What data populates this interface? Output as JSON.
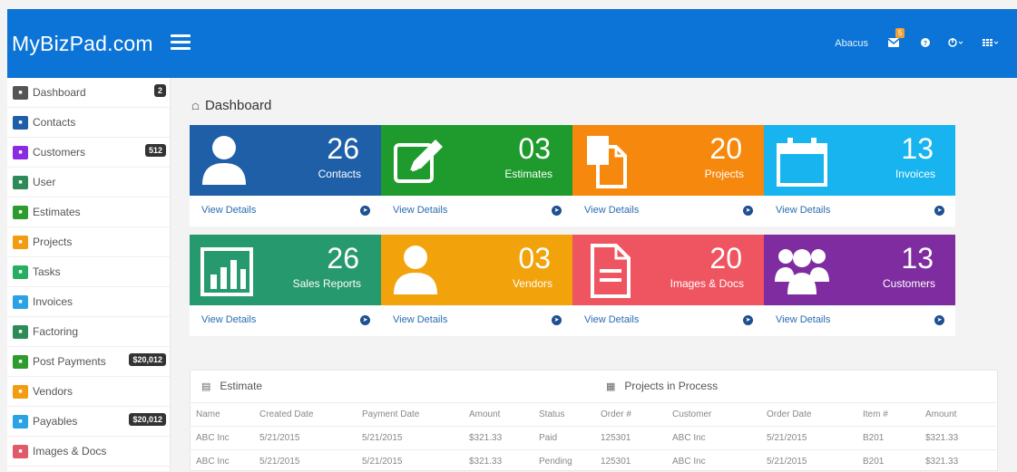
{
  "brand": "MyBizPad.com",
  "topbar": {
    "user": "Abacus",
    "mail_count": "5"
  },
  "sidebar": {
    "items": [
      {
        "label": "Dashboard",
        "icon": "dashboard-icon",
        "color": "#555555",
        "badge": "2"
      },
      {
        "label": "Contacts",
        "icon": "contacts-icon",
        "color": "#1f5ea8",
        "badge": ""
      },
      {
        "label": "Customers",
        "icon": "customers-icon",
        "color": "#8a2be2",
        "badge": "512"
      },
      {
        "label": "User",
        "icon": "user-icon",
        "color": "#2e8b57",
        "badge": ""
      },
      {
        "label": "Estimates",
        "icon": "estimates-icon",
        "color": "#2e9b2e",
        "badge": ""
      },
      {
        "label": "Projects",
        "icon": "projects-icon",
        "color": "#f39c12",
        "badge": ""
      },
      {
        "label": "Tasks",
        "icon": "tasks-icon",
        "color": "#27ae60",
        "badge": ""
      },
      {
        "label": "Invoices",
        "icon": "invoices-icon",
        "color": "#2aa3e6",
        "badge": ""
      },
      {
        "label": "Factoring",
        "icon": "factoring-icon",
        "color": "#2e8b57",
        "badge": ""
      },
      {
        "label": "Post Payments",
        "icon": "post-payments-icon",
        "color": "#2e9b2e",
        "badge": "$20,012"
      },
      {
        "label": "Vendors",
        "icon": "vendors-icon",
        "color": "#f39c12",
        "badge": ""
      },
      {
        "label": "Payables",
        "icon": "payables-icon",
        "color": "#2aa3e6",
        "badge": "$20,012"
      },
      {
        "label": "Images & Docs",
        "icon": "images-docs-icon",
        "color": "#e05b6a",
        "badge": ""
      }
    ]
  },
  "breadcrumb": "Dashboard",
  "tiles": [
    {
      "count": "26",
      "label": "Contacts",
      "color": "#1e5fa8",
      "icon": "user-icon",
      "link": "View Details"
    },
    {
      "count": "03",
      "label": "Estimates",
      "color": "#1f9b2d",
      "icon": "edit-icon",
      "link": "View Details"
    },
    {
      "count": "20",
      "label": "Projects",
      "color": "#f6890d",
      "icon": "files-icon",
      "link": "View Details"
    },
    {
      "count": "13",
      "label": "Invoices",
      "color": "#18b4ef",
      "icon": "calendar-icon",
      "link": "View Details"
    },
    {
      "count": "26",
      "label": "Sales Reports",
      "color": "#27996f",
      "icon": "bar-chart-icon",
      "link": "View Details"
    },
    {
      "count": "03",
      "label": "Vendors",
      "color": "#f2a20b",
      "icon": "user-icon",
      "link": "View Details"
    },
    {
      "count": "20",
      "label": "Images & Docs",
      "color": "#ef5560",
      "icon": "document-icon",
      "link": "View Details"
    },
    {
      "count": "13",
      "label": "Customers",
      "color": "#7f2ca0",
      "icon": "group-icon",
      "link": "View Details"
    }
  ],
  "estimate_panel": {
    "title": "Estimate",
    "columns": [
      "Name",
      "Created Date",
      "Payment Date",
      "Amount",
      "Status"
    ],
    "rows": [
      [
        "ABC Inc",
        "5/21/2015",
        "5/21/2015",
        "$321.33",
        "Paid"
      ],
      [
        "ABC Inc",
        "5/21/2015",
        "5/21/2015",
        "$321.33",
        "Pending"
      ]
    ]
  },
  "projects_panel": {
    "title": "Projects in Process",
    "columns": [
      "Order #",
      "Customer",
      "Order Date",
      "Item #",
      "Amount"
    ],
    "rows": [
      [
        "125301",
        "ABC Inc",
        "5/21/2015",
        "B201",
        "$321.33"
      ],
      [
        "125301",
        "ABC Inc",
        "5/21/2015",
        "B201",
        "$321.33"
      ]
    ]
  }
}
